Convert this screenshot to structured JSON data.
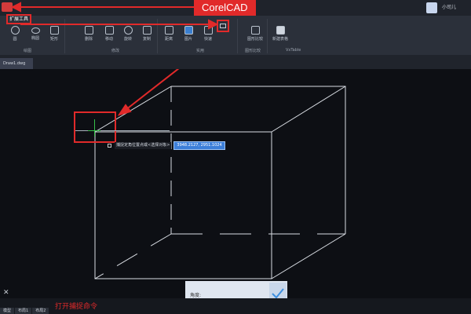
{
  "window": {
    "title": "CorelCAD",
    "user_name": "小司儿"
  },
  "ribbon": {
    "extension_tab": "扩展工具",
    "buttons": [
      {
        "label": "圆",
        "icon": "circle-icon"
      },
      {
        "label": "椭圆",
        "icon": "ellipse-icon"
      },
      {
        "label": "矩形",
        "icon": "rectangle-icon"
      },
      {
        "label": "删除",
        "icon": "erase-icon"
      },
      {
        "label": "移动",
        "icon": "move-icon"
      },
      {
        "label": "旋转",
        "icon": "rotate-icon"
      },
      {
        "label": "复制",
        "icon": "copy-icon"
      },
      {
        "label": "距离",
        "icon": "distance-icon"
      },
      {
        "label": "图片",
        "icon": "image-icon"
      },
      {
        "label": "快速",
        "icon": "quick-icon"
      },
      {
        "label": "图形比较",
        "icon": "compare-icon"
      },
      {
        "label": "新建表格",
        "icon": "table-icon"
      }
    ],
    "groups": [
      "绘图",
      "修改",
      "实用",
      "图形比较",
      "VxTable"
    ]
  },
  "document": {
    "tab_label": "Draw1.dwg"
  },
  "command": {
    "prompt_text": "捕捉定角位置点或<选择对象>",
    "input_value": "3948.2127, 2951.1024"
  },
  "dialog": {
    "label": "角度:"
  },
  "status": {
    "close_glyph": "✕",
    "layout_tabs": [
      "模型",
      "布局1",
      "布局2"
    ],
    "caption": "打开捕捉命令"
  },
  "colors": {
    "accent": "#e12a2a",
    "canvas": "#0d0f14",
    "ribbon": "#2b303a",
    "input": "#3d7fd9"
  }
}
